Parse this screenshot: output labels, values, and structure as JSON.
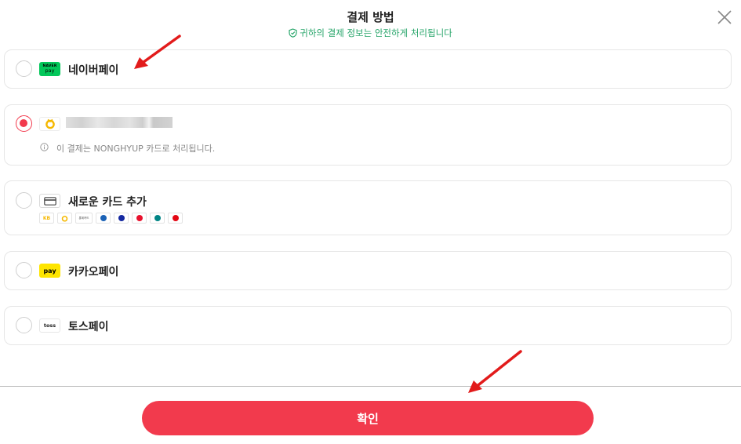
{
  "header": {
    "title": "결제 방법",
    "subtitle": "귀하의 결제 정보는 안전하게 처리됩니다"
  },
  "methods": [
    {
      "id": "naverpay",
      "label": "네이버페이",
      "logo_text": [
        "NAVER",
        "pay"
      ],
      "selected": false,
      "logo_color": "#03c75a"
    },
    {
      "id": "nonghyup",
      "label": "",
      "selected": true,
      "info": "이 결제는 NONGHYUP 카드로 처리됩니다."
    },
    {
      "id": "new-card",
      "label": "새로운 카드 추가",
      "selected": false
    },
    {
      "id": "kakaopay",
      "label": "카카오페이",
      "logo_text": "pay",
      "selected": false,
      "logo_color": "#fee500"
    },
    {
      "id": "tosspay",
      "label": "토스페이",
      "logo_text": "toss",
      "selected": false
    }
  ],
  "card_brands": [
    {
      "name": "kb",
      "color": "#f5b800",
      "text": "KB"
    },
    {
      "name": "nh",
      "color": "#f5b800"
    },
    {
      "name": "lotte",
      "color": "#555555",
      "text": "롯데카드"
    },
    {
      "name": "shinhan",
      "color": "#1b62b6"
    },
    {
      "name": "samsung",
      "color": "#1428a0",
      "text": "SS"
    },
    {
      "name": "hyundai",
      "color": "#e8112d"
    },
    {
      "name": "hana",
      "color": "#008485"
    },
    {
      "name": "bc",
      "color": "#e30613"
    }
  ],
  "footer": {
    "confirm_label": "확인"
  },
  "colors": {
    "accent": "#f23a4d",
    "secure_green": "#27a56a",
    "annotation_red": "#e21b1b"
  }
}
